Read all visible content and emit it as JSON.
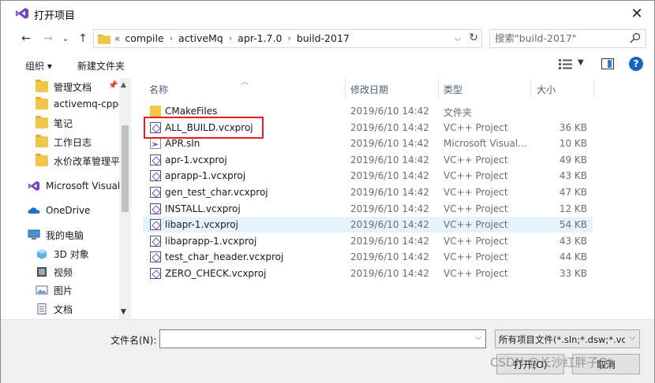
{
  "window": {
    "title": "打开项目"
  },
  "address": {
    "overflow": "«",
    "crumbs": [
      "compile",
      "activeMq",
      "apr-1.7.0",
      "build-2017"
    ]
  },
  "search": {
    "placeholder": "搜索\"build-2017\""
  },
  "toolbar": {
    "organize_label": "组织 ▾",
    "new_folder_label": "新建文件夹"
  },
  "sidebar": {
    "items": [
      {
        "label": "管理文档",
        "icon": "folder-icon",
        "pinned": true
      },
      {
        "label": "activemq-cpp-l",
        "icon": "folder-icon"
      },
      {
        "label": "笔记",
        "icon": "folder-icon"
      },
      {
        "label": "工作日志",
        "icon": "folder-icon"
      },
      {
        "label": "水价改革管理平·",
        "icon": "folder-icon"
      },
      {
        "label": "Microsoft Visual",
        "icon": "visual-studio-icon"
      },
      {
        "label": "OneDrive",
        "icon": "onedrive-cloud-icon"
      },
      {
        "label": "我的电脑",
        "icon": "computer-icon"
      },
      {
        "label": "3D 对象",
        "icon": "3d-objects-icon"
      },
      {
        "label": "视频",
        "icon": "video-icon"
      },
      {
        "label": "图片",
        "icon": "pictures-icon"
      },
      {
        "label": "文档",
        "icon": "documents-icon"
      }
    ]
  },
  "columns": {
    "name": "名称",
    "date": "修改日期",
    "type": "类型",
    "size": "大小"
  },
  "files": [
    {
      "name": "CMakeFiles",
      "date": "2019/6/10 14:42",
      "type": "文件夹",
      "size": "",
      "icon": "folder-icon"
    },
    {
      "name": "ALL_BUILD.vcxproj",
      "date": "2019/6/10 14:42",
      "type": "VC++ Project",
      "size": "36 KB",
      "icon": "vcxproj-icon"
    },
    {
      "name": "APR.sln",
      "date": "2019/6/10 14:42",
      "type": "Microsoft Visual...",
      "size": "10 KB",
      "icon": "sln-icon"
    },
    {
      "name": "apr-1.vcxproj",
      "date": "2019/6/10 14:42",
      "type": "VC++ Project",
      "size": "49 KB",
      "icon": "vcxproj-icon"
    },
    {
      "name": "aprapp-1.vcxproj",
      "date": "2019/6/10 14:42",
      "type": "VC++ Project",
      "size": "43 KB",
      "icon": "vcxproj-icon"
    },
    {
      "name": "gen_test_char.vcxproj",
      "date": "2019/6/10 14:42",
      "type": "VC++ Project",
      "size": "47 KB",
      "icon": "vcxproj-icon"
    },
    {
      "name": "INSTALL.vcxproj",
      "date": "2019/6/10 14:42",
      "type": "VC++ Project",
      "size": "12 KB",
      "icon": "vcxproj-icon"
    },
    {
      "name": "libapr-1.vcxproj",
      "date": "2019/6/10 14:42",
      "type": "VC++ Project",
      "size": "54 KB",
      "icon": "vcxproj-icon",
      "selected": true
    },
    {
      "name": "libaprapp-1.vcxproj",
      "date": "2019/6/10 14:42",
      "type": "VC++ Project",
      "size": "43 KB",
      "icon": "vcxproj-icon"
    },
    {
      "name": "test_char_header.vcxproj",
      "date": "2019/6/10 14:42",
      "type": "VC++ Project",
      "size": "44 KB",
      "icon": "vcxproj-icon"
    },
    {
      "name": "ZERO_CHECK.vcxproj",
      "date": "2019/6/10 14:42",
      "type": "VC++ Project",
      "size": "33 KB",
      "icon": "vcxproj-icon"
    }
  ],
  "footer": {
    "filename_label": "文件名(N):",
    "filename_value": "",
    "filter_label": "所有项目文件(*.sln;*.dsw;*.vcw",
    "open_label": "打开(O)",
    "cancel_label": "取消"
  },
  "watermark": "CSDN @长沙红胖子Qt",
  "colors": {
    "accent": "#1565c0",
    "highlight": "#e02020",
    "selected_row": "#e5f3ff"
  }
}
